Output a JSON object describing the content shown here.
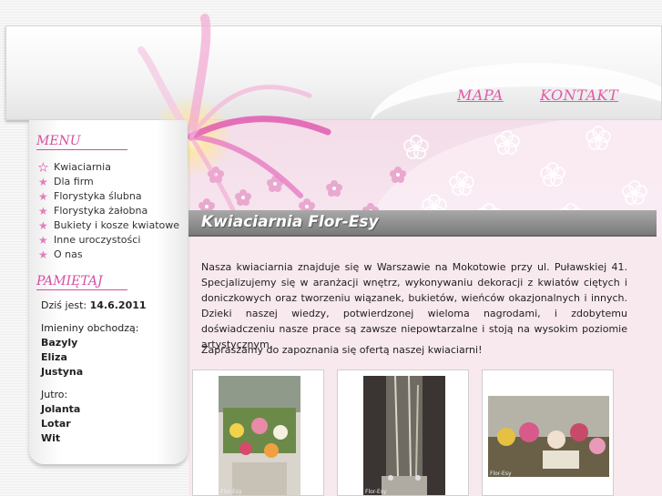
{
  "header": {
    "nav": {
      "mapa": "MAPA",
      "kontakt": "KONTAKT"
    }
  },
  "sidebar": {
    "menu_title": "MENU",
    "menu_items": [
      "Kwiaciarnia",
      "Dla firm",
      "Florystyka ślubna",
      "Florystyka żałobna",
      "Bukiety i kosze kwiatowe",
      "Inne uroczystości",
      "O nas"
    ],
    "pamietaj_title": "PAMIĘTAJ",
    "today_label": "Dziś jest:",
    "today_date": "14.6.2011",
    "names_today_label": "Imieniny obchodzą:",
    "names_today": [
      "Bazyly",
      "Eliza",
      "Justyna"
    ],
    "names_tomorrow_label": "Jutro:",
    "names_tomorrow": [
      "Jolanta",
      "Lotar",
      "Wit"
    ]
  },
  "main": {
    "title": "Kwiaciarnia Flor-Esy",
    "paragraph1": "Nasza kwiaciarnia znajduje się w Warszawie na Mokotowie przy ul. Puławskiej 41. Specjalizujemy się w aranżacji wnętrz, wykonywaniu dekoracji z kwiatów ciętych i doniczkowych oraz tworzeniu wiązanek, bukietów, wieńców okazjonalnych i innych. Dzieki naszej wiedzy, potwierdzonej wieloma nagrodami, i zdobytemu doświadczeniu nasze prace są zawsze niepowtarzalne i stoją na wysokim poziomie artystycznym.",
    "paragraph2": "Zapraszamy do zapoznania się ofertą naszej kwiaciarni!",
    "gallery_watermark": "Flor-Esy"
  },
  "colors": {
    "accent_pink": "#d64fa2",
    "title_bar": "#8d8d8d",
    "content_bg": "#f8e9ee"
  }
}
